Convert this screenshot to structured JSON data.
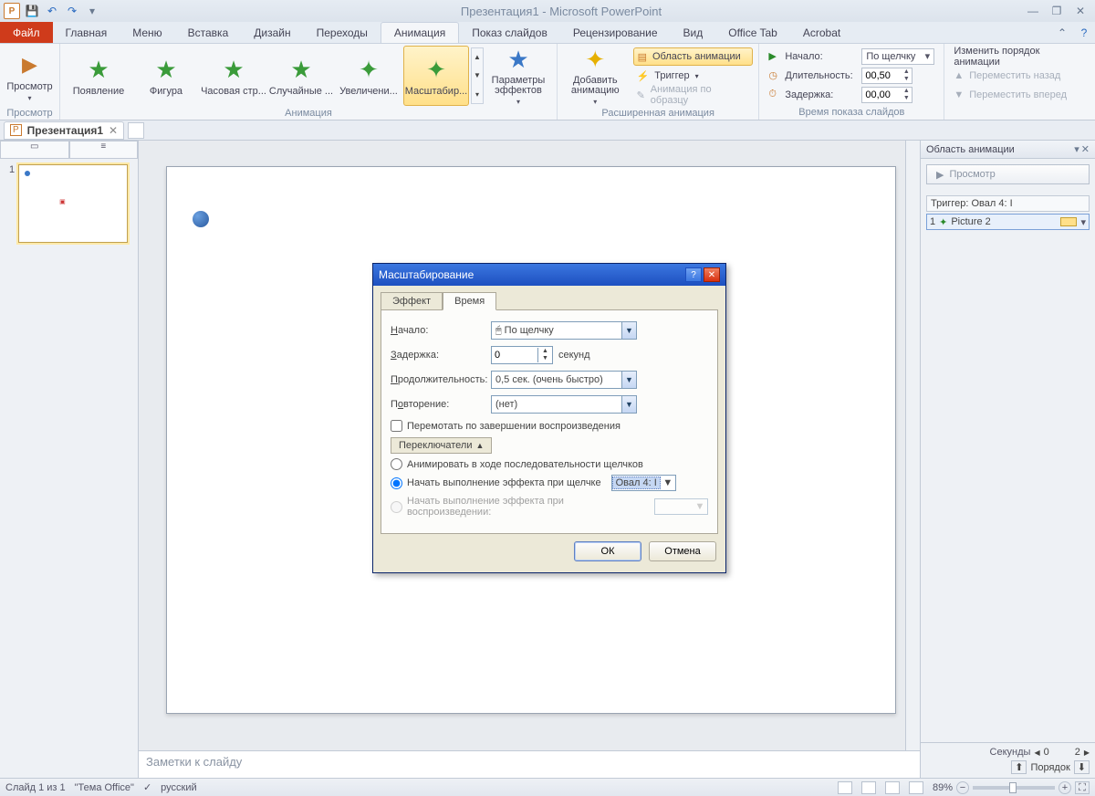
{
  "titlebar": {
    "title": "Презентация1 - Microsoft PowerPoint"
  },
  "tabs": {
    "file": "Файл",
    "items": [
      "Главная",
      "Меню",
      "Вставка",
      "Дизайн",
      "Переходы",
      "Анимация",
      "Показ слайдов",
      "Рецензирование",
      "Вид",
      "Office Tab",
      "Acrobat"
    ],
    "active_index": 5
  },
  "ribbon": {
    "preview": {
      "label": "Просмотр",
      "group": "Просмотр"
    },
    "gallery": [
      "Появление",
      "Фигура",
      "Часовая стр...",
      "Случайные ...",
      "Увеличени...",
      "Масштабир..."
    ],
    "gallery_sel": 5,
    "gallery_group": "Анимация",
    "effect_opts": "Параметры эффектов",
    "add_anim": "Добавить анимацию",
    "ext": {
      "pane": "Область анимации",
      "trigger": "Триггер",
      "sample": "Анимация по образцу",
      "group": "Расширенная анимация"
    },
    "timing": {
      "start_l": "Начало:",
      "start_v": "По щелчку",
      "dur_l": "Длительность:",
      "dur_v": "00,50",
      "delay_l": "Задержка:",
      "delay_v": "00,00",
      "group": "Время показа слайдов"
    },
    "reorder": {
      "title": "Изменить порядок анимации",
      "back": "Переместить назад",
      "fwd": "Переместить вперед"
    }
  },
  "doctab": {
    "name": "Презентация1"
  },
  "thumb": {
    "num": "1"
  },
  "notes": "Заметки к слайду",
  "apane": {
    "title": "Область анимации",
    "play": "Просмотр",
    "trigger": "Триггер: Овал 4: I",
    "row_n": "1",
    "row_name": "Picture 2",
    "seconds": "Секунды",
    "t0": "0",
    "t2": "2",
    "order": "Порядок"
  },
  "status": {
    "slide": "Слайд 1 из 1",
    "theme": "\"Тема Office\"",
    "lang": "русский",
    "zoom": "89%"
  },
  "dialog": {
    "title": "Масштабирование",
    "tab_effect": "Эффект",
    "tab_time": "Время",
    "start_l": "Начало:",
    "start_v": "По щелчку",
    "delay_l": "Задержка:",
    "delay_v": "0",
    "delay_unit": "секунд",
    "dur_l": "Продолжительность:",
    "dur_v": "0,5 сек. (очень быстро)",
    "repeat_l": "Повторение:",
    "repeat_v": "(нет)",
    "rewind": "Перемотать по завершении воспроизведения",
    "toggles": "Переключатели",
    "r_seq": "Анимировать в ходе последовательности щелчков",
    "r_click": "Начать выполнение эффекта при щелчке",
    "r_click_v": "Овал 4: I",
    "r_play": "Начать выполнение эффекта при воспроизведении:",
    "ok": "ОК",
    "cancel": "Отмена"
  }
}
